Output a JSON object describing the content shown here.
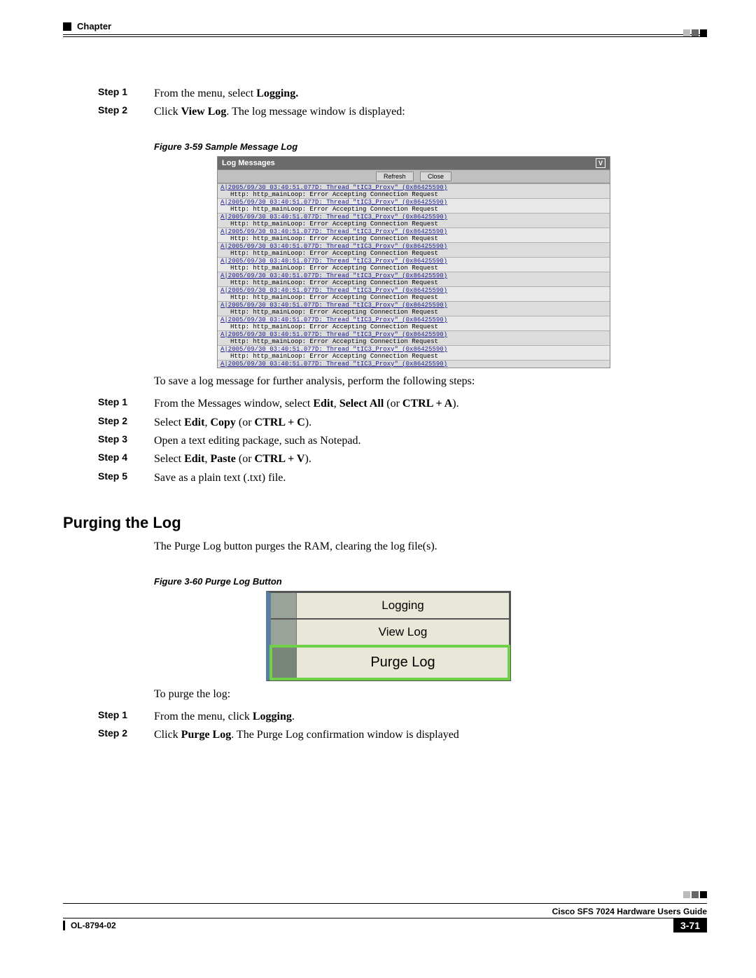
{
  "header": {
    "label": "Chapter"
  },
  "stepsA": [
    {
      "label": "Step 1",
      "html": "From the menu, select <b>Logging.</b>"
    },
    {
      "label": "Step 2",
      "html": "Click <b>View Log</b>. The log message window is displayed:"
    }
  ],
  "fig1": {
    "caption": "Figure 3-59   Sample Message Log",
    "title": "Log Messages",
    "corner": "V",
    "buttons": {
      "refresh": "Refresh",
      "close": "Close"
    },
    "log_line1": "A|2005/09/30 03:40:51.077D: Thread \"tIC3_Proxy\" (0x86425590)",
    "log_line2": "Http: http_mainLoop: Error Accepting Connection Request",
    "rows": 12
  },
  "intro_save": "To save a log message for further analysis, perform the following steps:",
  "stepsB": [
    {
      "label": "Step 1",
      "html": "From the Messages window, select <b>Edit</b>, <b>Select All</b> (or <b>CTRL + A</b>)."
    },
    {
      "label": "Step 2",
      "html": "Select <b>Edit</b>, <b>Copy</b> (or <b>CTRL + C</b>)."
    },
    {
      "label": "Step 3",
      "html": "Open a text editing package, such as Notepad."
    },
    {
      "label": "Step 4",
      "html": "Select <b>Edit</b>, <b>Paste</b> (or <b>CTRL + V</b>)."
    },
    {
      "label": "Step 5",
      "html": "Save as a plain text (.txt) file."
    }
  ],
  "sectionB": {
    "title": "Purging the Log",
    "intro": "The Purge Log button purges the RAM, clearing the log file(s).",
    "caption": "Figure 3-60   Purge Log Button",
    "menu": {
      "logging": "Logging",
      "view_log": "View Log",
      "purge_log": "Purge Log"
    },
    "lead": "To purge the log:"
  },
  "stepsC": [
    {
      "label": "Step 1",
      "html": "From the menu, click <b>Logging</b>."
    },
    {
      "label": "Step 2",
      "html": "Click <b>Purge Log</b>. The Purge Log confirmation window is displayed"
    }
  ],
  "footer": {
    "title": "Cisco SFS 7024 Hardware Users Guide",
    "doc": "OL-8794-02",
    "page": "3-71"
  }
}
